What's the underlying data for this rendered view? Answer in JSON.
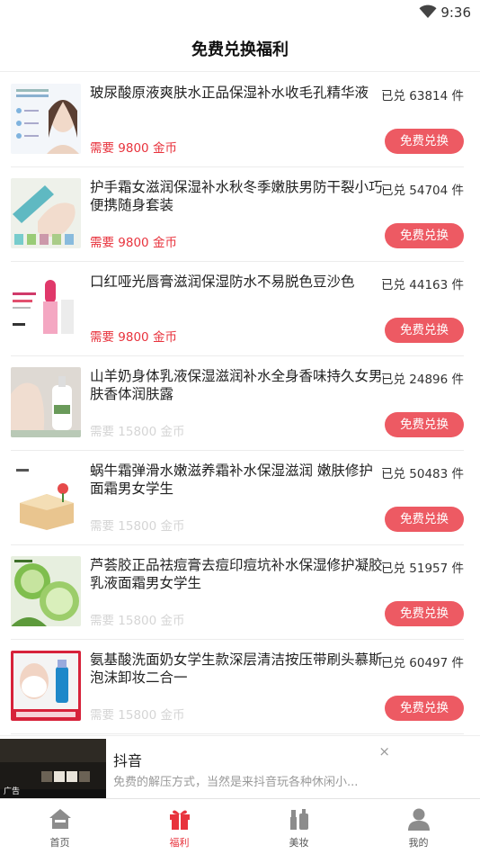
{
  "status": {
    "time": "9:36"
  },
  "header": {
    "title": "免费兑换福利"
  },
  "items": [
    {
      "name": "玻尿酸原液爽肤水正品保湿补水收毛孔精华液",
      "count": "已兑 63814 件",
      "price": "需要 9800 金币",
      "button": "免费兑换"
    },
    {
      "name": "护手霜女滋润保湿补水秋冬季嫩肤男防干裂小巧便携随身套装",
      "count": "已兑 54704 件",
      "price": "需要 9800 金币",
      "button": "免费兑换"
    },
    {
      "name": "口红哑光唇膏滋润保湿防水不易脱色豆沙色",
      "count": "已兑 44163 件",
      "price": "需要 9800 金币",
      "button": "免费兑换"
    },
    {
      "name": "山羊奶身体乳液保湿滋润补水全身香味持久女男肤香体润肤露",
      "count": "已兑 24896 件",
      "price": "需要 15800 金币",
      "button": "免费兑换"
    },
    {
      "name": "蜗牛霜弹滑水嫩滋养霜补水保湿滋润 嫩肤修护面霜男女学生",
      "count": "已兑 50483 件",
      "price": "需要 15800 金币",
      "button": "免费兑换"
    },
    {
      "name": "芦荟胶正品祛痘膏去痘印痘坑补水保湿修护凝胶乳液面霜男女学生",
      "count": "已兑 51957 件",
      "price": "需要 15800 金币",
      "button": "免费兑换"
    },
    {
      "name": "氨基酸洗面奶女学生款深层清洁按压带刷头慕斯泡沫卸妆二合一",
      "count": "已兑 60497 件",
      "price": "需要 15800 金币",
      "button": "免费兑换"
    }
  ],
  "ad": {
    "tag": "广告",
    "title": "抖音",
    "desc": "免费的解压方式，当然是来抖音玩各种休闲小...",
    "close": "×"
  },
  "tabs": [
    {
      "label": "首页",
      "icon": "home-icon"
    },
    {
      "label": "福利",
      "icon": "gift-icon"
    },
    {
      "label": "美妆",
      "icon": "makeup-icon"
    },
    {
      "label": "我的",
      "icon": "user-icon"
    }
  ],
  "colors": {
    "accent": "#e8333d",
    "button": "#ed5a63",
    "muted_price": "#d5d5d5"
  }
}
